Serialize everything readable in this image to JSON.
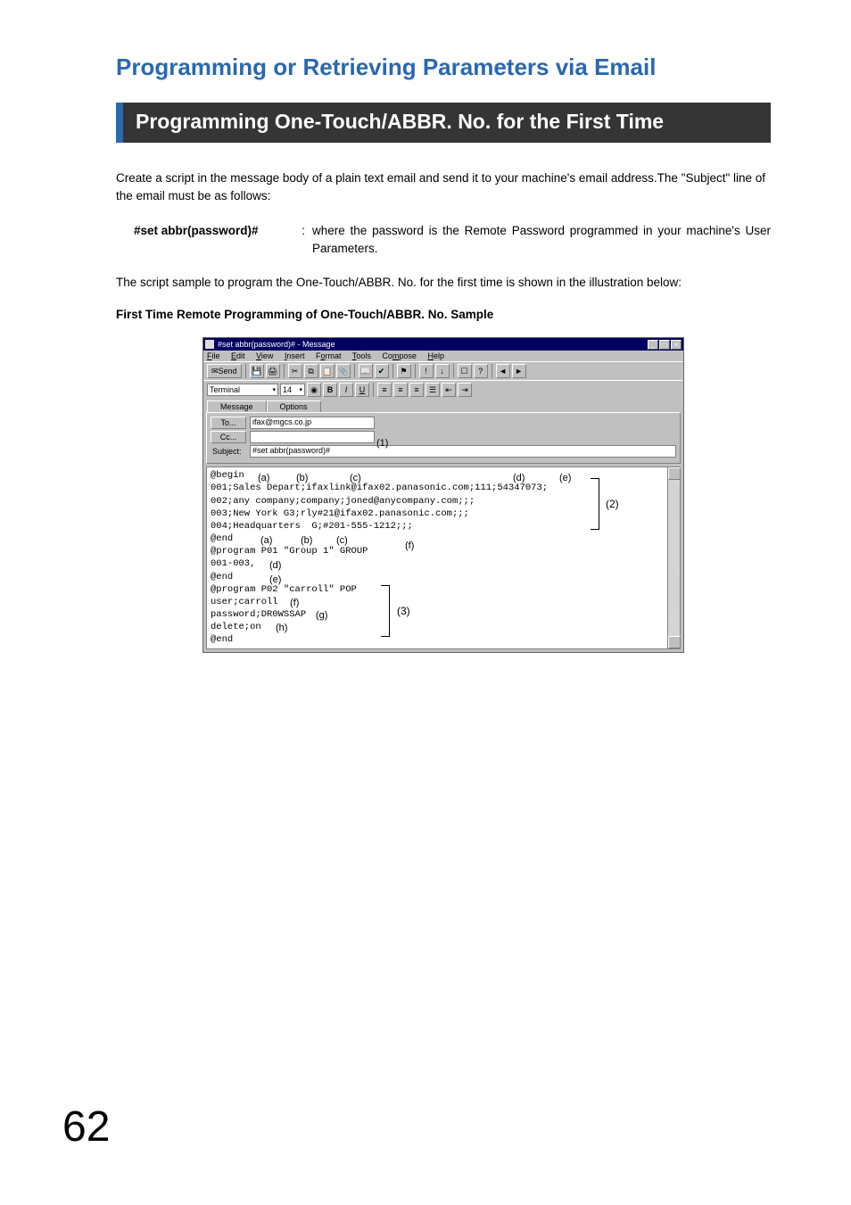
{
  "page_number": "62",
  "main_title": "Programming or Retrieving Parameters via Email",
  "section_title": "Programming One-Touch/ABBR. No. for the First Time",
  "intro_para": "Create a script in the message body of a plain text email and send it to your machine's email address.The \"Subject\" line of the email must be as follows:",
  "definition": {
    "key": "#set abbr(password)#",
    "colon": ":",
    "value": "where the password is the Remote Password programmed in your machine's User Parameters."
  },
  "second_para": "The script sample to program the One-Touch/ABBR. No. for the first time is shown in the illustration below:",
  "caption": "First Time Remote Programming of One-Touch/ABBR. No. Sample",
  "window": {
    "title": "#set abbr(password)# - Message",
    "menus": [
      "File",
      "Edit",
      "View",
      "Insert",
      "Format",
      "Tools",
      "Compose",
      "Help"
    ],
    "send_label": "Send",
    "font_name": "Terminal",
    "font_size": "14",
    "tabs": [
      "Message",
      "Options"
    ],
    "to_button": "To...",
    "to_value": "ifax@mgcs.co.jp",
    "cc_button": "Cc...",
    "cc_value": "",
    "subject_label": "Subject:",
    "subject_value": "#set abbr(password)#",
    "body_lines": [
      "@begin",
      "001;Sales Depart;ifaxlink@ifax02.panasonic.com;111;54347073;",
      "002;any company;company;joned@anycompany.com;;;",
      "003;New York G3;rly#21@ifax02.panasonic.com;;;",
      "004;Headquarters  G;#201-555-1212;;;",
      "@end",
      "@program P01 \"Group 1\" GROUP",
      "001-003,",
      "@end",
      "@program P02 \"carroll\" POP",
      "user;carroll",
      "password;DR0WSSAP",
      "delete;on",
      "@end"
    ],
    "annot_labels": {
      "a1": "(a)",
      "b1": "(b)",
      "c1": "(c)",
      "d1": "(d)",
      "e1": "(e)",
      "a2": "(a)",
      "b2": "(b)",
      "c2": "(c)",
      "f2": "(f)",
      "d2": "(d)",
      "e2": "(e)",
      "f3": "(f)",
      "g3": "(g)",
      "h3": "(h)",
      "num1": "(1)",
      "num2": "(2)",
      "num3": "(3)"
    }
  }
}
